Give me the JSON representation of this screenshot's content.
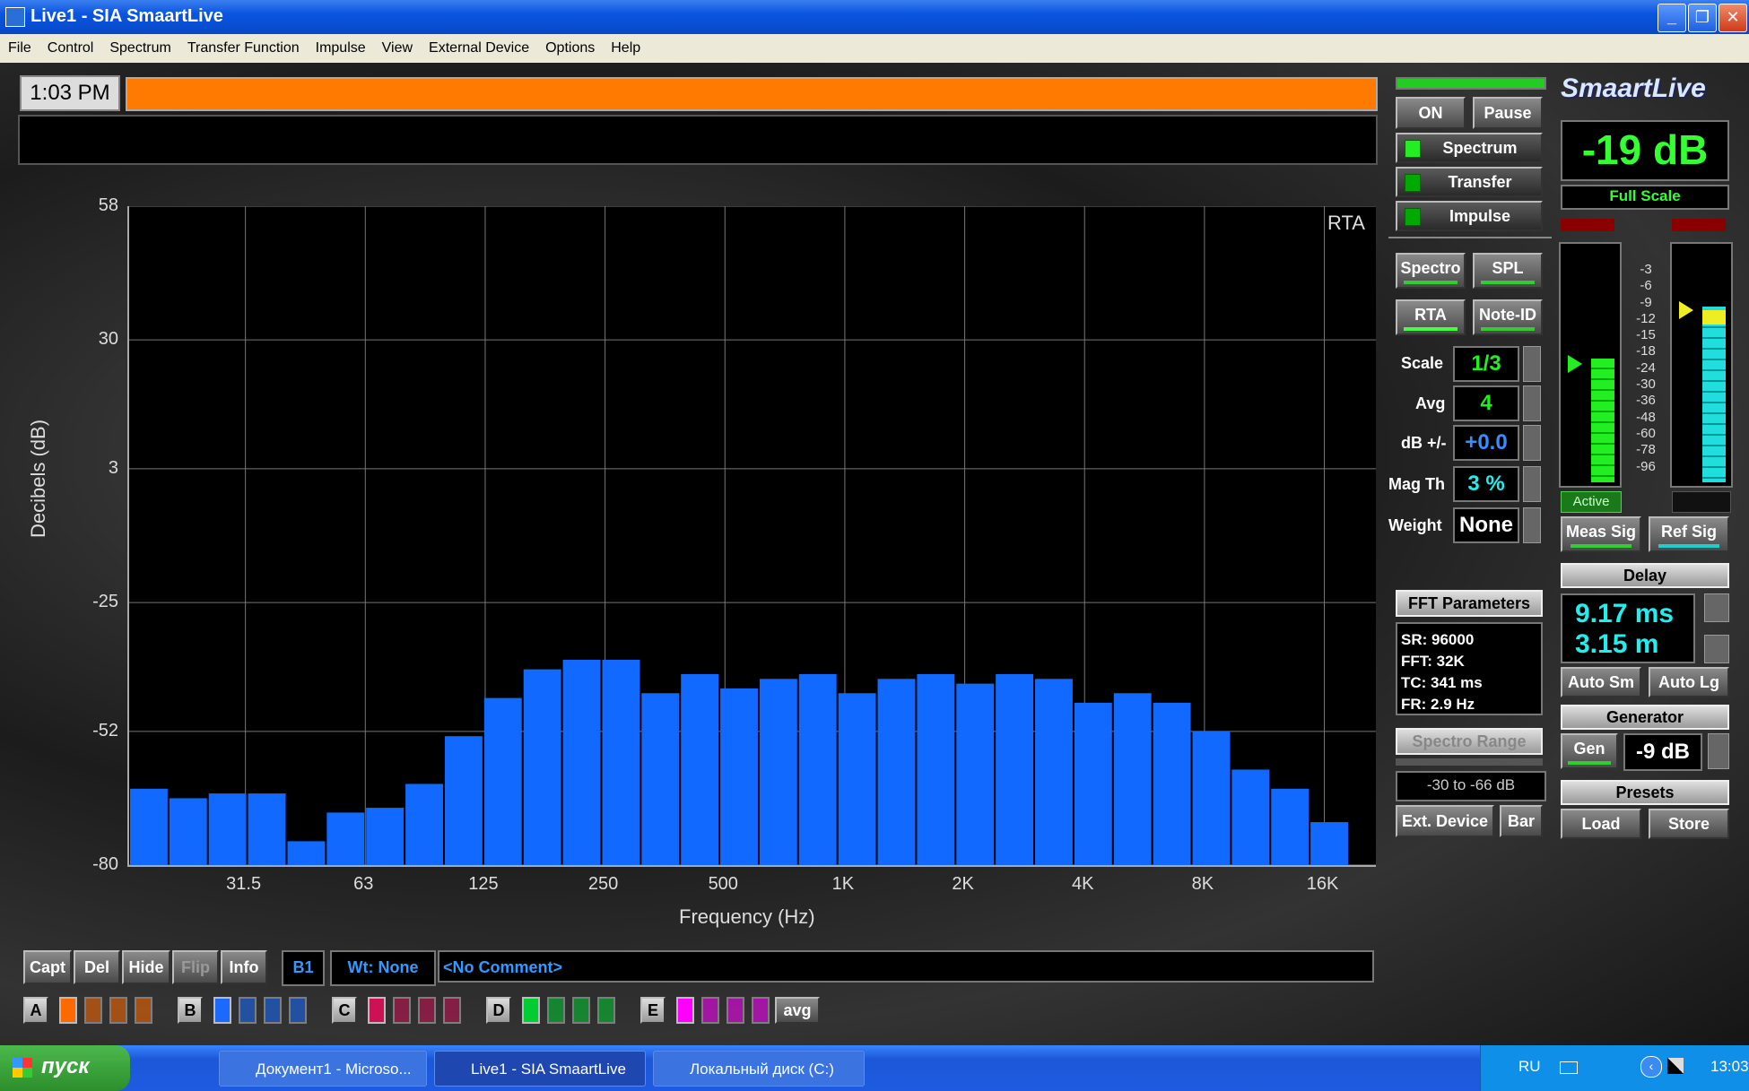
{
  "window": {
    "title": "Live1 - SIA SmaartLive"
  },
  "menu": [
    "File",
    "Control",
    "Spectrum",
    "Transfer Function",
    "Impulse",
    "View",
    "External Device",
    "Options",
    "Help"
  ],
  "header": {
    "clock": "1:03 PM"
  },
  "logo": "SmaartLive",
  "plot": {
    "mode_label": "RTA",
    "ylabel": "Decibels (dB)",
    "xlabel": "Frequency (Hz)"
  },
  "chart_data": {
    "type": "bar",
    "title": "",
    "xlabel": "Frequency (Hz)",
    "ylabel": "Decibels (dB)",
    "ylim": [
      -80,
      58
    ],
    "yticks": [
      58,
      30,
      3,
      -25,
      -52,
      -80
    ],
    "xtick_labels": [
      "31.5",
      "63",
      "125",
      "250",
      "500",
      "1K",
      "2K",
      "4K",
      "8K",
      "16K"
    ],
    "series": [
      {
        "values": [
          -64,
          -66,
          -65,
          -65,
          -75,
          -69,
          -68,
          -63,
          -53,
          -45,
          -39,
          -37,
          -37,
          -44,
          -40,
          -43,
          -41,
          -40,
          -44,
          -41,
          -40,
          -42,
          -40,
          -41,
          -46,
          -44,
          -46,
          -52,
          -60,
          -64,
          -71
        ]
      }
    ]
  },
  "controls": {
    "on": "ON",
    "pause": "Pause",
    "spectrum": "Spectrum",
    "transfer": "Transfer",
    "impulse": "Impulse",
    "spectro": "Spectro",
    "spl": "SPL",
    "rta": "RTA",
    "noteid": "Note-ID",
    "scale_label": "Scale",
    "scale_value": "1/3",
    "avg_label": "Avg",
    "avg_value": "4",
    "db_label": "dB +/-",
    "db_value": "+0.0",
    "magth_label": "Mag Th",
    "magth_value": "3 %",
    "weight_label": "Weight",
    "weight_value": "None",
    "fft_header": "FFT Parameters",
    "fft_lines": [
      "SR: 96000",
      "FFT: 32K",
      "TC: 341 ms",
      "FR: 2.9 Hz"
    ],
    "spectro_range": "Spectro Range",
    "spectro_range_value": "-30 to -66 dB",
    "ext_device": "Ext. Device",
    "bar": "Bar"
  },
  "meter": {
    "level": "-19 dB",
    "full_scale": "Full Scale",
    "scale_marks": [
      "-3",
      "-6",
      "-9",
      "-12",
      "-15",
      "-18",
      "-24",
      "-30",
      "-36",
      "-48",
      "-60",
      "-78",
      "-96"
    ],
    "active": "Active",
    "meas_sig": "Meas Sig",
    "ref_sig": "Ref Sig",
    "delay_header": "Delay",
    "delay_ms": "9.17 ms",
    "delay_m": "3.15 m",
    "auto_sm": "Auto Sm",
    "auto_lg": "Auto Lg",
    "generator_header": "Generator",
    "gen": "Gen",
    "gen_level": "-9 dB",
    "presets_header": "Presets",
    "load": "Load",
    "store": "Store"
  },
  "bottom": {
    "capt": "Capt",
    "del": "Del",
    "hide": "Hide",
    "flip": "Flip",
    "info": "Info",
    "b1": "B1",
    "wt": "Wt: None",
    "comment": "<No Comment>",
    "groups": [
      "A",
      "B",
      "C",
      "D",
      "E"
    ],
    "avg": "avg",
    "group_colors": [
      "#ff6a00",
      "#1a6aff",
      "#cc1155",
      "#00cc33",
      "#ff00ff"
    ]
  },
  "taskbar": {
    "start": "пуск",
    "tasks": [
      "Документ1 - Microso...",
      "Live1 - SIA SmaartLive",
      "Локальный диск (C:)"
    ],
    "lang": "RU",
    "time": "13:03"
  }
}
